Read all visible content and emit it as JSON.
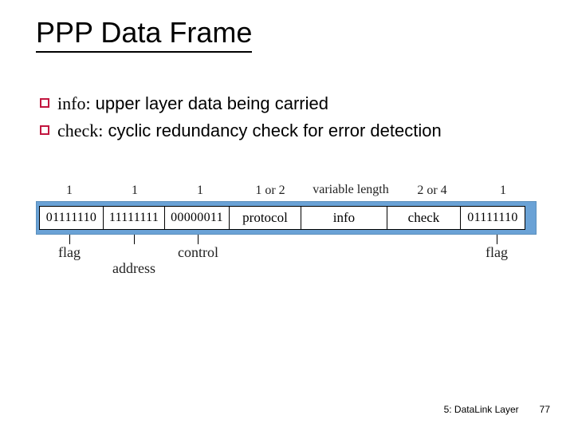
{
  "title": "PPP Data Frame",
  "bullets": [
    {
      "kw": "info:",
      "rest": " upper layer data being carried"
    },
    {
      "kw": "check:",
      "rest": "  cyclic redundancy check for error detection"
    }
  ],
  "frame": {
    "sizes": [
      "1",
      "1",
      "1",
      "1 or 2",
      "variable length",
      "2 or 4",
      "1"
    ],
    "cells": [
      "01111110",
      "11111111",
      "00000011",
      "protocol",
      "info",
      "check",
      "01111110"
    ],
    "labels": {
      "flag_left": "flag",
      "address": "address",
      "control": "control",
      "flag_right": "flag"
    }
  },
  "footer": {
    "section": "5: DataLink Layer",
    "page": "77"
  }
}
